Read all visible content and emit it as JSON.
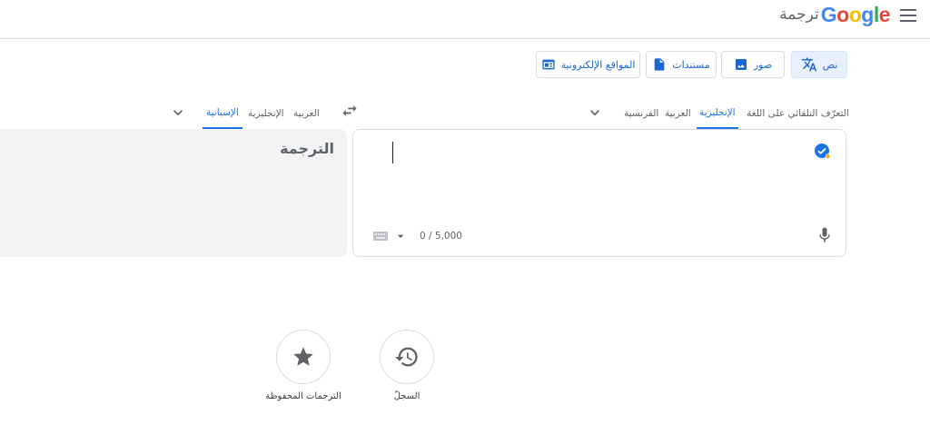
{
  "header": {
    "logo_text": "Google",
    "product_name": "ترجمة",
    "menu_icon": "hamburger-menu-icon"
  },
  "modes": [
    {
      "label": "نص",
      "icon": "translate-icon",
      "active": true
    },
    {
      "label": "صور",
      "icon": "image-icon",
      "active": false
    },
    {
      "label": "مستندات",
      "icon": "document-icon",
      "active": false
    },
    {
      "label": "المواقع الإلكترونية",
      "icon": "website-icon",
      "active": false
    }
  ],
  "source_langs": {
    "detect": "التعرّف التلقائي على اللغة",
    "selected": "الإنجليزية",
    "arabic": "العربية",
    "french": "الفرنسية"
  },
  "target_langs": {
    "selected": "الإسبانية",
    "english": "الإنجليزية",
    "arabic": "العربية"
  },
  "source": {
    "char_count": "0 / 5,000"
  },
  "target": {
    "placeholder": "الترجمة"
  },
  "bottom": {
    "history_label": "السجلّ",
    "saved_label": "الترجمات المحفوظة"
  },
  "colors": {
    "accent": "#1a73e8",
    "active_bg": "#e8f0fe",
    "target_bg": "#f1f3f4"
  }
}
